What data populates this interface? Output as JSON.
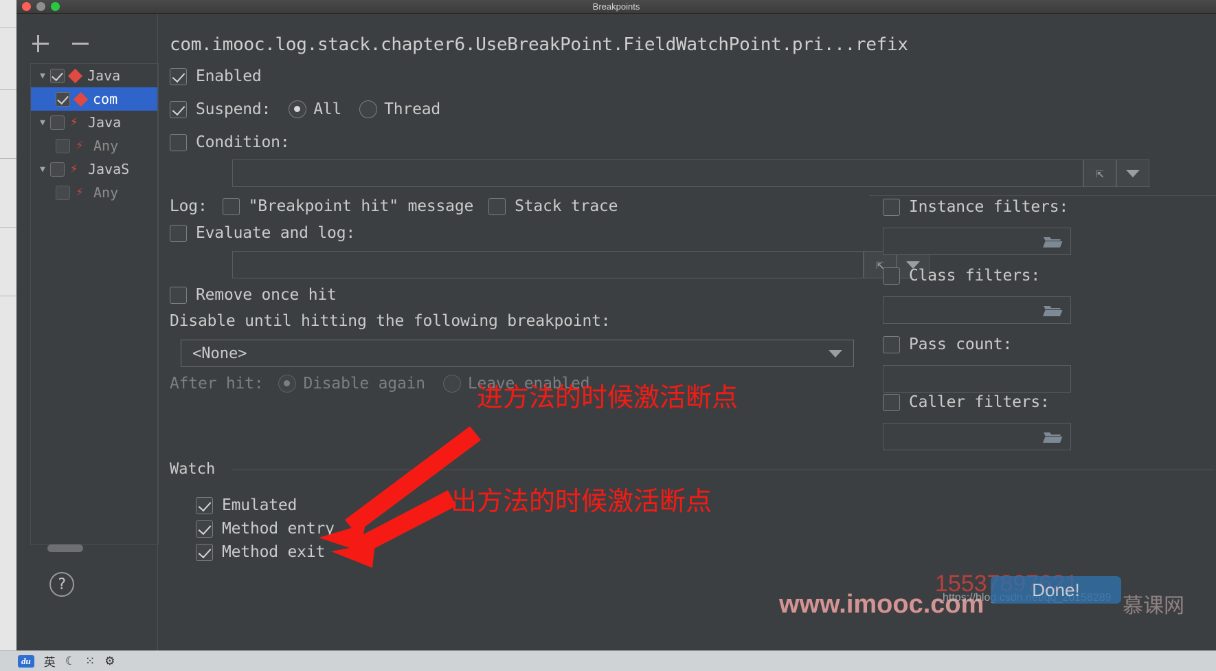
{
  "window": {
    "title": "Breakpoints",
    "traffic_lights": [
      "close",
      "minimize",
      "zoom"
    ]
  },
  "toolbar": {
    "add_label": "+",
    "remove_label": "−"
  },
  "tree": {
    "items": [
      {
        "arrow": "▼",
        "checked": true,
        "icon": "diamond-red",
        "label": "Java",
        "selected": false,
        "indent": false,
        "muted": false
      },
      {
        "arrow": "",
        "checked": true,
        "icon": "diamond-red",
        "label": "com",
        "selected": true,
        "indent": true,
        "muted": false
      },
      {
        "arrow": "▼",
        "checked": false,
        "icon": "bolt-red",
        "label": "Java",
        "selected": false,
        "indent": false,
        "muted": false
      },
      {
        "arrow": "",
        "checked": false,
        "icon": "bolt-hollow",
        "label": "Any",
        "selected": false,
        "indent": true,
        "muted": true
      },
      {
        "arrow": "▼",
        "checked": false,
        "icon": "bolt-red",
        "label": "JavaS",
        "selected": false,
        "indent": false,
        "muted": false
      },
      {
        "arrow": "",
        "checked": false,
        "icon": "bolt-hollow",
        "label": "Any",
        "selected": false,
        "indent": true,
        "muted": true
      }
    ],
    "help_label": "?"
  },
  "detail": {
    "breakpoint_title": "com.imooc.log.stack.chapter6.UseBreakPoint.FieldWatchPoint.pri...refix",
    "enabled": {
      "label": "Enabled",
      "checked": true
    },
    "suspend": {
      "label": "Suspend:",
      "checked": true,
      "options": [
        "All",
        "Thread"
      ],
      "selected": "All"
    },
    "condition": {
      "label": "Condition:",
      "checked": false,
      "value": ""
    },
    "log": {
      "label": "Log:",
      "breakpoint_hit": {
        "label": "\"Breakpoint hit\" message",
        "checked": false
      },
      "stack_trace": {
        "label": "Stack trace",
        "checked": false
      }
    },
    "evaluate_and_log": {
      "label": "Evaluate and log:",
      "checked": false,
      "value": ""
    },
    "remove_once_hit": {
      "label": "Remove once hit",
      "checked": false
    },
    "disable_until": {
      "label": "Disable until hitting the following breakpoint:",
      "selected": "<None>"
    },
    "after_hit": {
      "label": "After hit:",
      "options": [
        "Disable again",
        "Leave enabled"
      ],
      "selected": "Disable again",
      "disabled": true
    },
    "watch": {
      "section_label": "Watch",
      "items": [
        {
          "label": "Emulated",
          "checked": true
        },
        {
          "label": "Method entry",
          "checked": true
        },
        {
          "label": "Method exit",
          "checked": true
        }
      ]
    }
  },
  "filters": {
    "instance": {
      "label": "Instance filters:",
      "checked": false,
      "value": "",
      "has_browse": true
    },
    "class": {
      "label": "Class filters:",
      "checked": false,
      "value": "",
      "has_browse": true
    },
    "pass_count": {
      "label": "Pass count:",
      "checked": false,
      "value": "",
      "has_browse": false
    },
    "caller": {
      "label": "Caller filters:",
      "checked": false,
      "value": "",
      "has_browse": true
    }
  },
  "annotations": {
    "color": "#f51b14",
    "entry_note": "进方法的时候激活断点",
    "exit_note": "出方法的时候激活断点"
  },
  "watermarks": {
    "imooc": "www.imooc.com",
    "phone": "15537897621",
    "csdn": "https://blog.csdn.net/qq_20158289",
    "done": "Done!",
    "mooc_cn": "慕课网"
  },
  "dock": {
    "ime": "du",
    "lang": "英",
    "moon": "☾",
    "mic": "⁙",
    "gear": "⚙"
  }
}
